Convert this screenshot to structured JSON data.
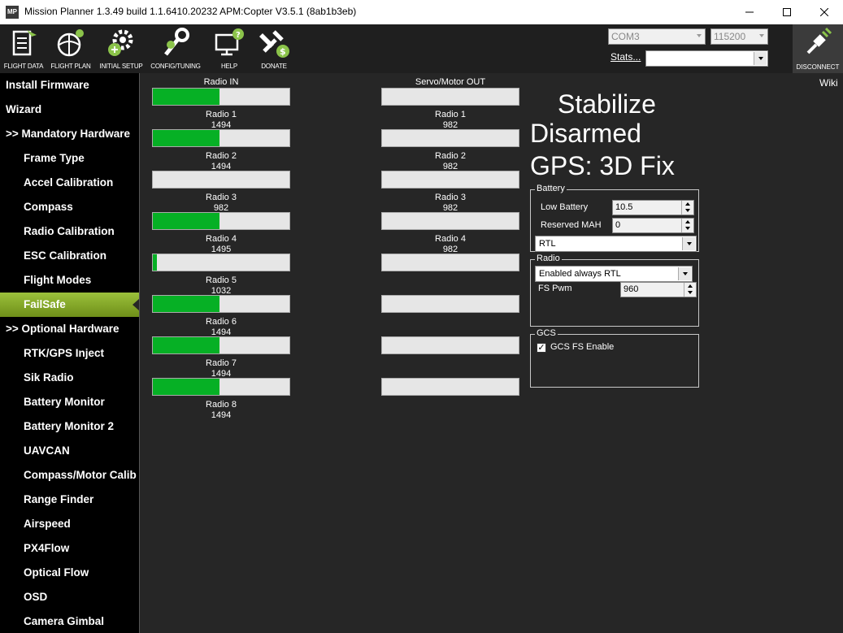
{
  "window": {
    "app_icon_text": "MP",
    "title": "Mission Planner 1.3.49 build 1.1.6410.20232 APM:Copter V3.5.1 (8ab1b3eb)"
  },
  "toolbar": {
    "buttons": [
      {
        "label": "FLIGHT DATA",
        "icon": "flight-data-icon"
      },
      {
        "label": "FLIGHT PLAN",
        "icon": "flight-plan-icon"
      },
      {
        "label": "INITIAL SETUP",
        "icon": "initial-setup-icon"
      },
      {
        "label": "CONFIG/TUNING",
        "icon": "config-tuning-icon"
      },
      {
        "label": "HELP",
        "icon": "help-icon"
      },
      {
        "label": "DONATE",
        "icon": "donate-icon"
      }
    ],
    "com_port": "COM3",
    "baud_rate": "115200",
    "stats_label": "Stats...",
    "disconnect_label": "DISCONNECT"
  },
  "sidebar": {
    "items": [
      {
        "label": "Install Firmware",
        "level": "top"
      },
      {
        "label": "Wizard",
        "level": "top"
      },
      {
        "label": ">> Mandatory Hardware",
        "level": "top"
      },
      {
        "label": "Frame Type",
        "level": "sub"
      },
      {
        "label": "Accel Calibration",
        "level": "sub"
      },
      {
        "label": "Compass",
        "level": "sub"
      },
      {
        "label": "Radio Calibration",
        "level": "sub"
      },
      {
        "label": "ESC Calibration",
        "level": "sub"
      },
      {
        "label": "Flight Modes",
        "level": "sub"
      },
      {
        "label": "FailSafe",
        "level": "sub",
        "active": true
      },
      {
        "label": ">> Optional Hardware",
        "level": "top"
      },
      {
        "label": "RTK/GPS Inject",
        "level": "sub"
      },
      {
        "label": "Sik Radio",
        "level": "sub"
      },
      {
        "label": "Battery Monitor",
        "level": "sub"
      },
      {
        "label": "Battery Monitor 2",
        "level": "sub"
      },
      {
        "label": "UAVCAN",
        "level": "sub"
      },
      {
        "label": "Compass/Motor Calib",
        "level": "sub"
      },
      {
        "label": "Range Finder",
        "level": "sub"
      },
      {
        "label": "Airspeed",
        "level": "sub"
      },
      {
        "label": "PX4Flow",
        "level": "sub"
      },
      {
        "label": "Optical Flow",
        "level": "sub"
      },
      {
        "label": "OSD",
        "level": "sub"
      },
      {
        "label": "Camera Gimbal",
        "level": "sub"
      }
    ]
  },
  "main": {
    "wiki_label": "Wiki",
    "radio_in": {
      "header": "Radio IN",
      "channels": [
        {
          "label": "Radio 1",
          "value": "1494",
          "level": 0.49
        },
        {
          "label": "Radio 2",
          "value": "1494",
          "level": 0.49
        },
        {
          "label": "Radio 3",
          "value": "982",
          "level": 0.0
        },
        {
          "label": "Radio 4",
          "value": "1495",
          "level": 0.49
        },
        {
          "label": "Radio 5",
          "value": "1032",
          "level": 0.03
        },
        {
          "label": "Radio 6",
          "value": "1494",
          "level": 0.49
        },
        {
          "label": "Radio 7",
          "value": "1494",
          "level": 0.49
        },
        {
          "label": "Radio 8",
          "value": "1494",
          "level": 0.49
        }
      ]
    },
    "servo_out": {
      "header": "Servo/Motor OUT",
      "channels": [
        {
          "label": "Radio 1",
          "value": "982",
          "level": 0.0
        },
        {
          "label": "Radio 2",
          "value": "982",
          "level": 0.0
        },
        {
          "label": "Radio 3",
          "value": "982",
          "level": 0.0
        },
        {
          "label": "Radio 4",
          "value": "982",
          "level": 0.0
        },
        {
          "label": "",
          "value": "",
          "level": 0.0
        },
        {
          "label": "",
          "value": "",
          "level": 0.0
        },
        {
          "label": "",
          "value": "",
          "level": 0.0
        },
        {
          "label": "",
          "value": "",
          "level": 0.0
        }
      ]
    },
    "status": {
      "mode": "Stabilize",
      "armed": "Disarmed",
      "gps": "GPS: 3D Fix"
    },
    "battery": {
      "title": "Battery",
      "low_battery_label": "Low Battery",
      "low_battery_value": "10.5",
      "reserved_mah_label": "Reserved MAH",
      "reserved_mah_value": "0",
      "action": "RTL"
    },
    "radio": {
      "title": "Radio",
      "action": "Enabled always RTL",
      "fs_pwm_label": "FS Pwm",
      "fs_pwm_value": "960"
    },
    "gcs": {
      "title": "GCS",
      "enable_label": "GCS FS Enable",
      "enabled": true,
      "check_glyph": "✓"
    }
  },
  "colors": {
    "bar_fill": "#06b025",
    "active_item": "#8cb22e",
    "background": "#262626"
  }
}
